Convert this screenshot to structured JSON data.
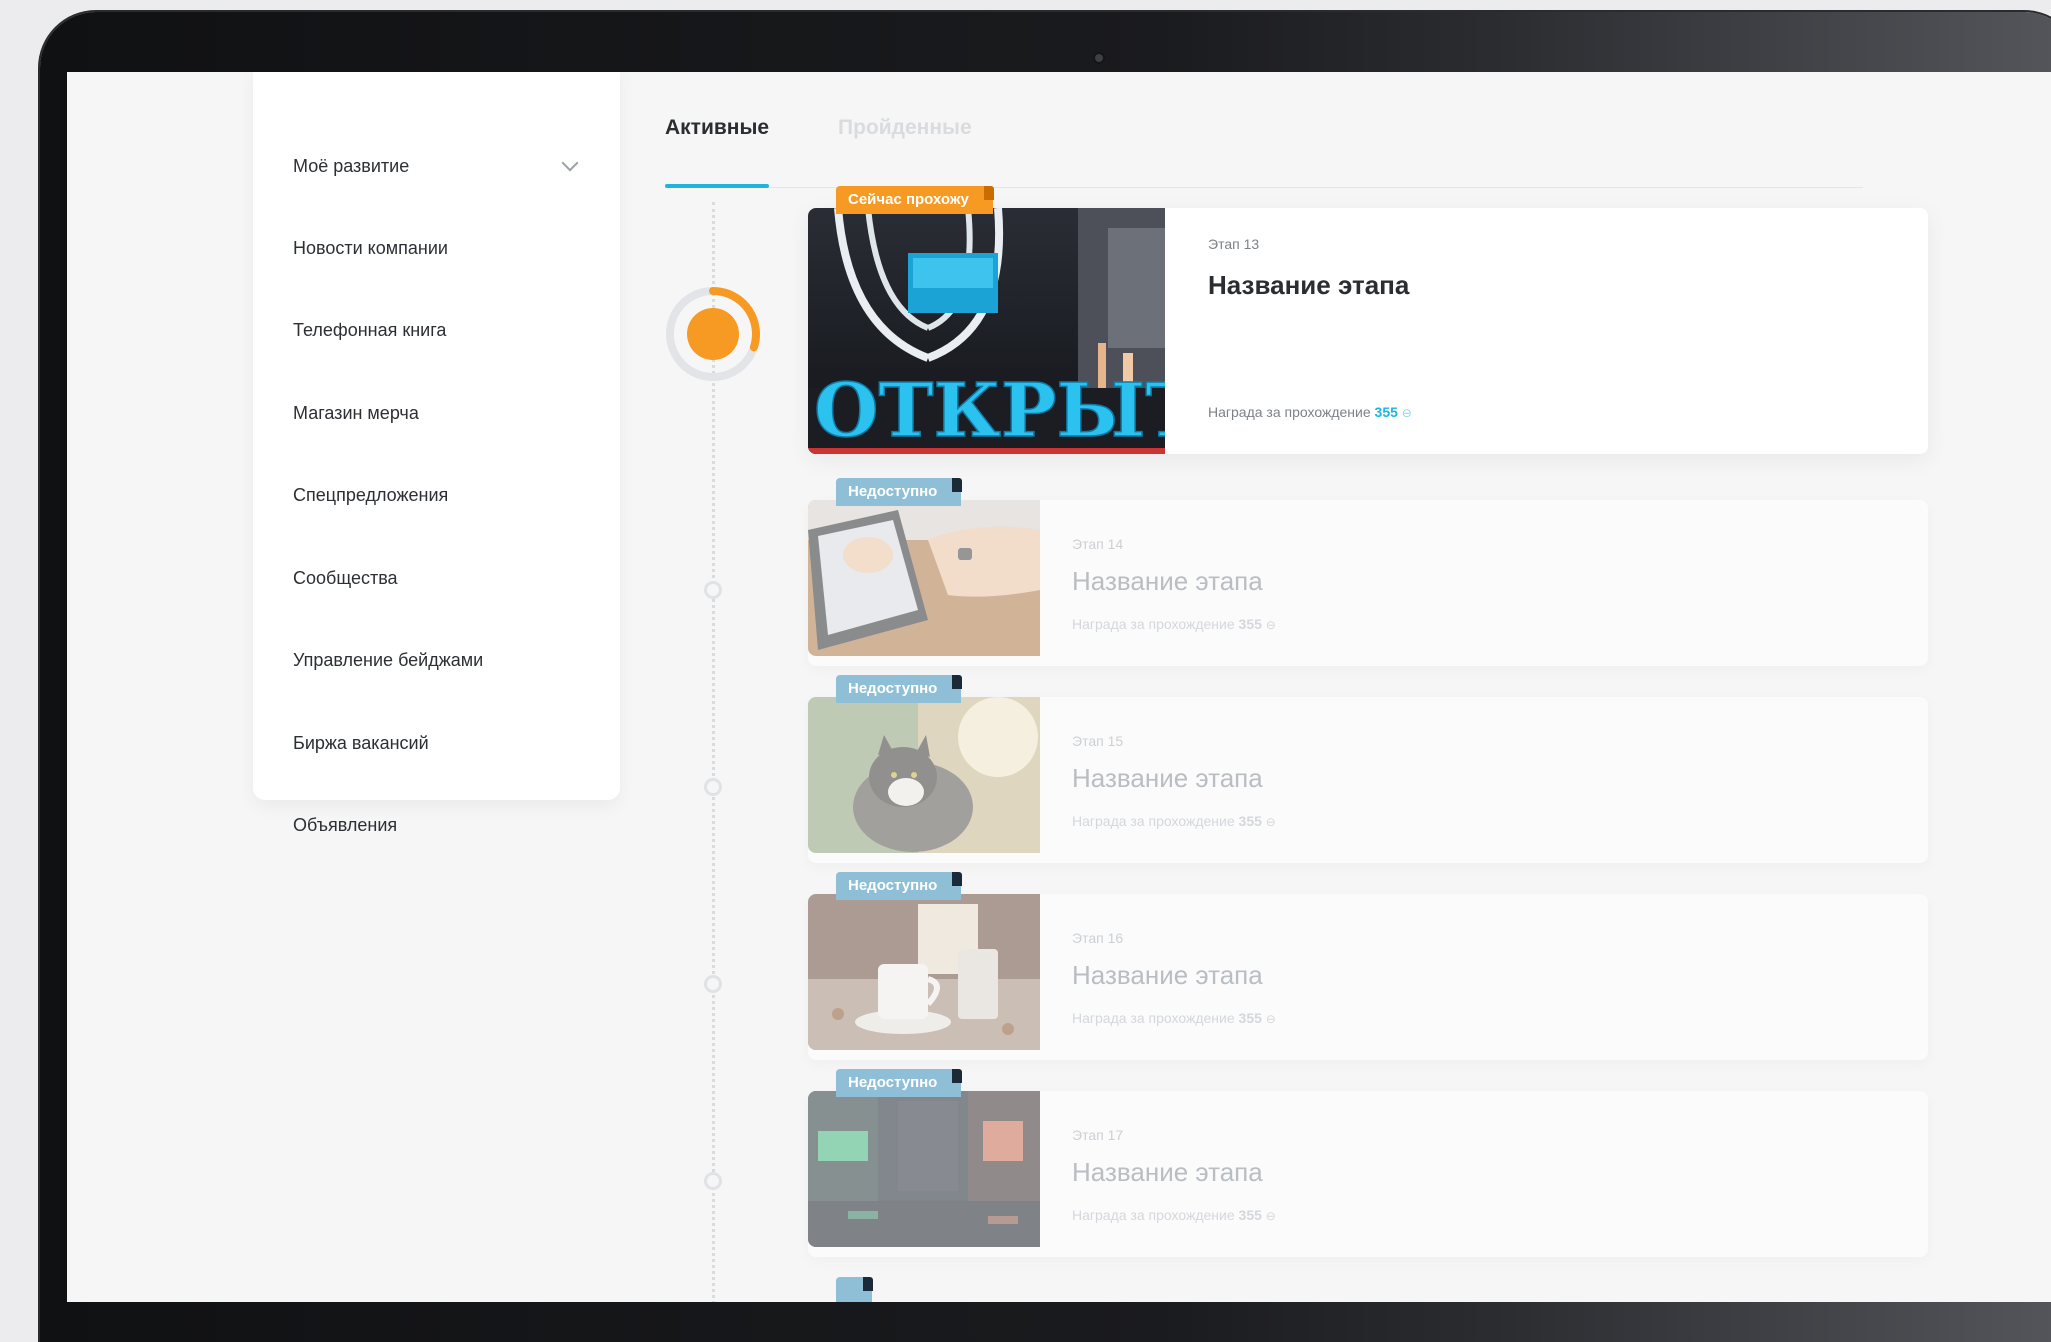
{
  "sidebar": {
    "items": [
      {
        "label": "Моё развитие",
        "has_chevron": true
      },
      {
        "label": "Новости компании"
      },
      {
        "label": "Телефонная книга"
      },
      {
        "label": "Магазин мерча"
      },
      {
        "label": "Спецпредложения"
      },
      {
        "label": "Сообщества"
      },
      {
        "label": "Управление бейджами"
      },
      {
        "label": "Биржа вакансий"
      },
      {
        "label": "Объявления"
      }
    ]
  },
  "tabs": {
    "active": "Активные",
    "inactive": "Пройденные"
  },
  "progress": {
    "fraction": 0.3,
    "color": "#f79a23",
    "track_color": "#e2e4e7"
  },
  "stages": [
    {
      "badge": "Сейчас прохожу",
      "stage": "Этап 13",
      "title": "Название этапа",
      "reward_label": "Награда за прохождение",
      "reward_value": "355",
      "reward_icon": "coin-icon",
      "image": "exhibition-stand",
      "image_text": "ОТКРЫТ",
      "state": "current"
    },
    {
      "badge": "Недоступно",
      "stage": "Этап 14",
      "title": "Название этапа",
      "reward_label": "Награда за прохождение",
      "reward_value": "355",
      "reward_icon": "coin-icon",
      "image": "hands-tablet",
      "state": "locked"
    },
    {
      "badge": "Недоступно",
      "stage": "Этап 15",
      "title": "Название этапа",
      "reward_label": "Награда за прохождение",
      "reward_value": "355",
      "reward_icon": "coin-icon",
      "image": "cat",
      "state": "locked"
    },
    {
      "badge": "Недоступно",
      "stage": "Этап 16",
      "title": "Название этапа",
      "reward_label": "Награда за прохождение",
      "reward_value": "355",
      "reward_icon": "coin-icon",
      "image": "coffee-cup",
      "state": "locked"
    },
    {
      "badge": "Недоступно",
      "stage": "Этап 17",
      "title": "Название этапа",
      "reward_label": "Награда за прохождение",
      "reward_value": "355",
      "reward_icon": "coin-icon",
      "image": "night-street",
      "state": "locked"
    }
  ],
  "colors": {
    "accent": "#1fb4df",
    "current_badge": "#f79a23",
    "locked_badge": "#8ebfd6"
  }
}
